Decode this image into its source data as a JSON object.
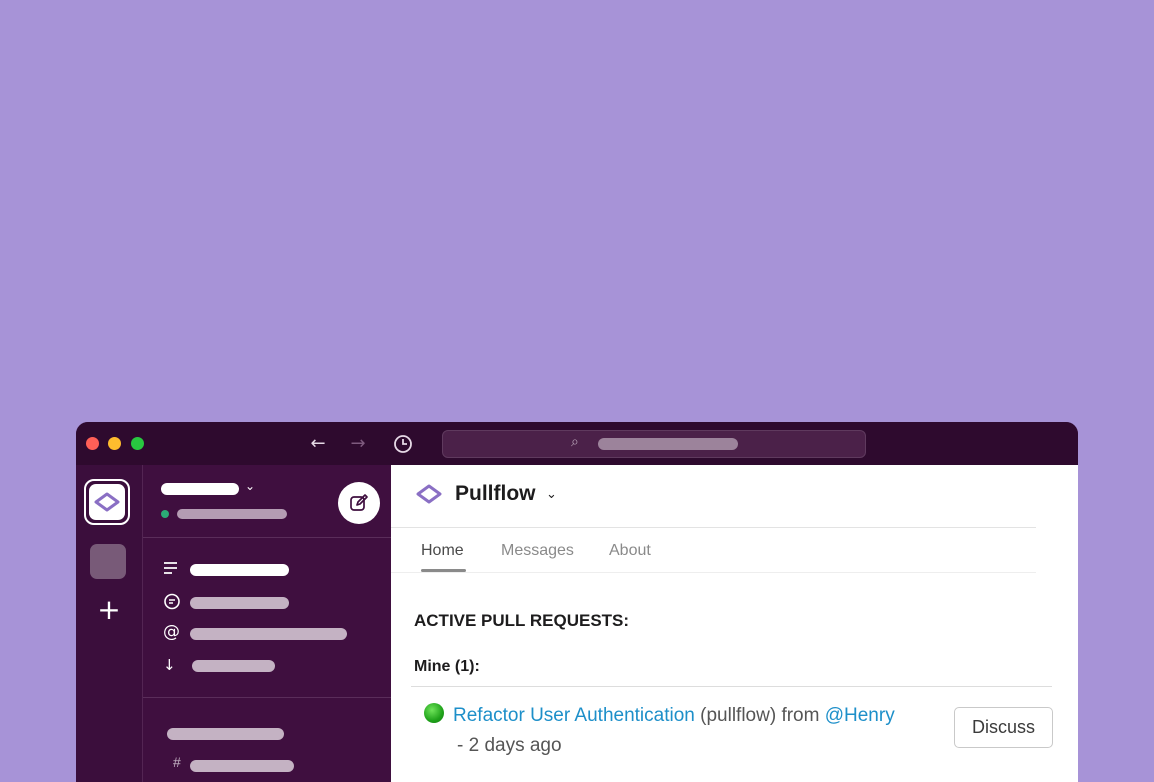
{
  "window": {
    "nav": {
      "back_icon": "←",
      "forward_icon": "→",
      "history_icon": "🕒"
    },
    "search": {
      "icon": "search-icon"
    }
  },
  "rail": {
    "add_icon": "+"
  },
  "sidebar": {
    "hash_icon": "#"
  },
  "app": {
    "name": "Pullflow",
    "chevron": "⌄",
    "tabs": [
      {
        "label": "Home"
      },
      {
        "label": "Messages"
      },
      {
        "label": "About"
      }
    ],
    "section_title": "ACTIVE PULL REQUESTS:",
    "group_label": "Mine (1):",
    "pull_requests": [
      {
        "title": "Refactor User Authentication",
        "repo": "(pullflow)",
        "from_text": "from",
        "author": "@Henry",
        "time": "- 2 days ago",
        "action_label": "Discuss",
        "status_color": "#1fa21a"
      }
    ]
  },
  "colors": {
    "background": "#a793d7",
    "titlebar": "#2e0a2e",
    "sidebar": "#3f0f3f",
    "link": "#1d8fc9",
    "brand_purple": "#8a6fc4"
  }
}
